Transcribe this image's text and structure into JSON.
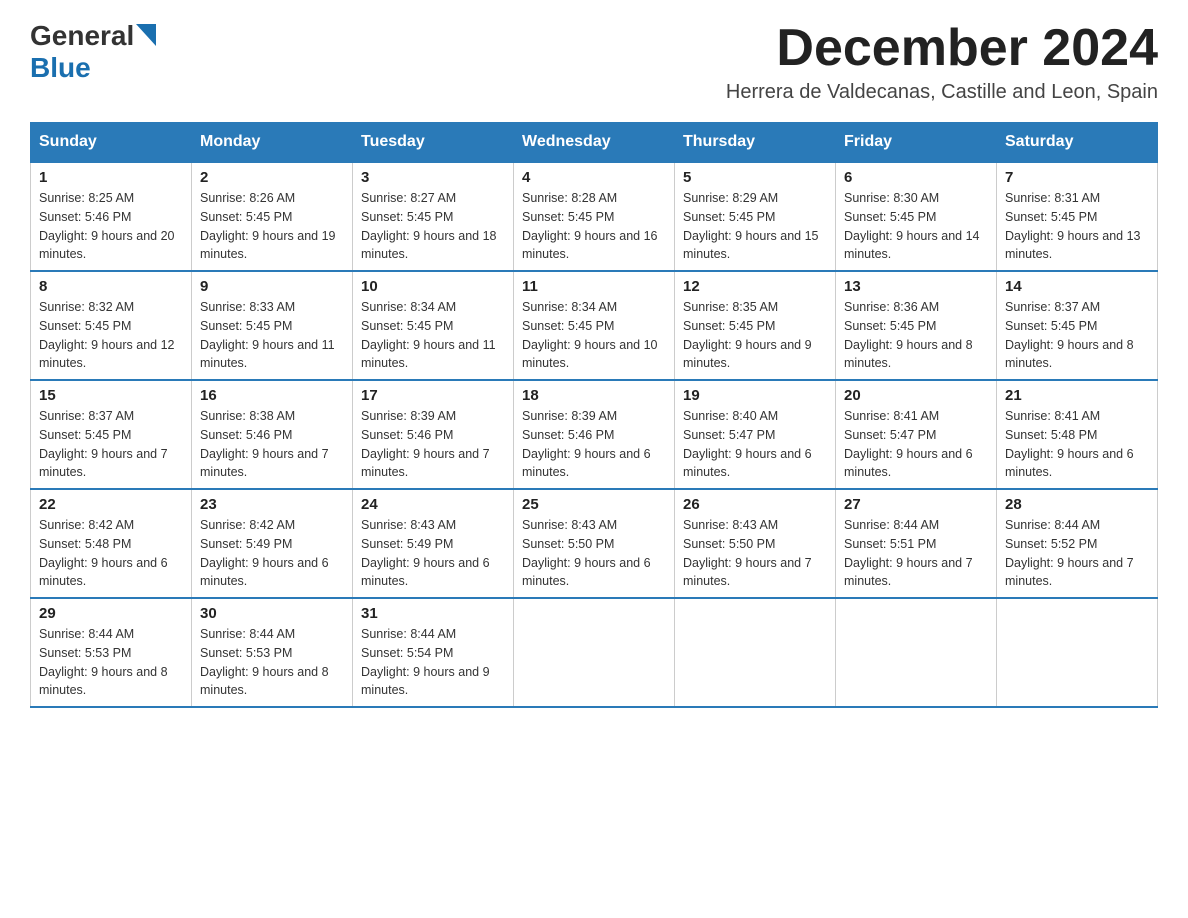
{
  "logo": {
    "general": "General",
    "triangle": "▶",
    "blue": "Blue"
  },
  "title": "December 2024",
  "location": "Herrera de Valdecanas, Castille and Leon, Spain",
  "headers": [
    "Sunday",
    "Monday",
    "Tuesday",
    "Wednesday",
    "Thursday",
    "Friday",
    "Saturday"
  ],
  "weeks": [
    [
      {
        "day": "1",
        "sunrise": "8:25 AM",
        "sunset": "5:46 PM",
        "daylight": "9 hours and 20 minutes."
      },
      {
        "day": "2",
        "sunrise": "8:26 AM",
        "sunset": "5:45 PM",
        "daylight": "9 hours and 19 minutes."
      },
      {
        "day": "3",
        "sunrise": "8:27 AM",
        "sunset": "5:45 PM",
        "daylight": "9 hours and 18 minutes."
      },
      {
        "day": "4",
        "sunrise": "8:28 AM",
        "sunset": "5:45 PM",
        "daylight": "9 hours and 16 minutes."
      },
      {
        "day": "5",
        "sunrise": "8:29 AM",
        "sunset": "5:45 PM",
        "daylight": "9 hours and 15 minutes."
      },
      {
        "day": "6",
        "sunrise": "8:30 AM",
        "sunset": "5:45 PM",
        "daylight": "9 hours and 14 minutes."
      },
      {
        "day": "7",
        "sunrise": "8:31 AM",
        "sunset": "5:45 PM",
        "daylight": "9 hours and 13 minutes."
      }
    ],
    [
      {
        "day": "8",
        "sunrise": "8:32 AM",
        "sunset": "5:45 PM",
        "daylight": "9 hours and 12 minutes."
      },
      {
        "day": "9",
        "sunrise": "8:33 AM",
        "sunset": "5:45 PM",
        "daylight": "9 hours and 11 minutes."
      },
      {
        "day": "10",
        "sunrise": "8:34 AM",
        "sunset": "5:45 PM",
        "daylight": "9 hours and 11 minutes."
      },
      {
        "day": "11",
        "sunrise": "8:34 AM",
        "sunset": "5:45 PM",
        "daylight": "9 hours and 10 minutes."
      },
      {
        "day": "12",
        "sunrise": "8:35 AM",
        "sunset": "5:45 PM",
        "daylight": "9 hours and 9 minutes."
      },
      {
        "day": "13",
        "sunrise": "8:36 AM",
        "sunset": "5:45 PM",
        "daylight": "9 hours and 8 minutes."
      },
      {
        "day": "14",
        "sunrise": "8:37 AM",
        "sunset": "5:45 PM",
        "daylight": "9 hours and 8 minutes."
      }
    ],
    [
      {
        "day": "15",
        "sunrise": "8:37 AM",
        "sunset": "5:45 PM",
        "daylight": "9 hours and 7 minutes."
      },
      {
        "day": "16",
        "sunrise": "8:38 AM",
        "sunset": "5:46 PM",
        "daylight": "9 hours and 7 minutes."
      },
      {
        "day": "17",
        "sunrise": "8:39 AM",
        "sunset": "5:46 PM",
        "daylight": "9 hours and 7 minutes."
      },
      {
        "day": "18",
        "sunrise": "8:39 AM",
        "sunset": "5:46 PM",
        "daylight": "9 hours and 6 minutes."
      },
      {
        "day": "19",
        "sunrise": "8:40 AM",
        "sunset": "5:47 PM",
        "daylight": "9 hours and 6 minutes."
      },
      {
        "day": "20",
        "sunrise": "8:41 AM",
        "sunset": "5:47 PM",
        "daylight": "9 hours and 6 minutes."
      },
      {
        "day": "21",
        "sunrise": "8:41 AM",
        "sunset": "5:48 PM",
        "daylight": "9 hours and 6 minutes."
      }
    ],
    [
      {
        "day": "22",
        "sunrise": "8:42 AM",
        "sunset": "5:48 PM",
        "daylight": "9 hours and 6 minutes."
      },
      {
        "day": "23",
        "sunrise": "8:42 AM",
        "sunset": "5:49 PM",
        "daylight": "9 hours and 6 minutes."
      },
      {
        "day": "24",
        "sunrise": "8:43 AM",
        "sunset": "5:49 PM",
        "daylight": "9 hours and 6 minutes."
      },
      {
        "day": "25",
        "sunrise": "8:43 AM",
        "sunset": "5:50 PM",
        "daylight": "9 hours and 6 minutes."
      },
      {
        "day": "26",
        "sunrise": "8:43 AM",
        "sunset": "5:50 PM",
        "daylight": "9 hours and 7 minutes."
      },
      {
        "day": "27",
        "sunrise": "8:44 AM",
        "sunset": "5:51 PM",
        "daylight": "9 hours and 7 minutes."
      },
      {
        "day": "28",
        "sunrise": "8:44 AM",
        "sunset": "5:52 PM",
        "daylight": "9 hours and 7 minutes."
      }
    ],
    [
      {
        "day": "29",
        "sunrise": "8:44 AM",
        "sunset": "5:53 PM",
        "daylight": "9 hours and 8 minutes."
      },
      {
        "day": "30",
        "sunrise": "8:44 AM",
        "sunset": "5:53 PM",
        "daylight": "9 hours and 8 minutes."
      },
      {
        "day": "31",
        "sunrise": "8:44 AM",
        "sunset": "5:54 PM",
        "daylight": "9 hours and 9 minutes."
      },
      null,
      null,
      null,
      null
    ]
  ]
}
